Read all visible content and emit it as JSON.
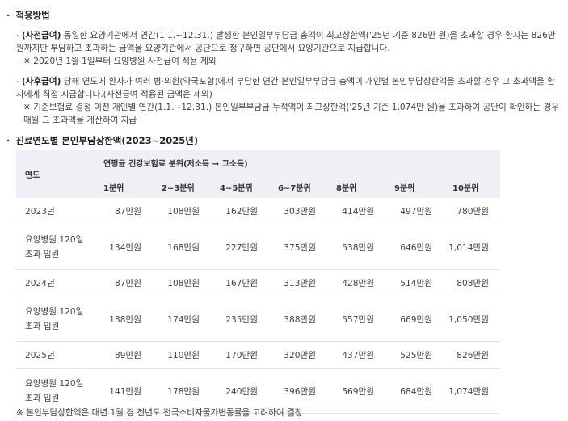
{
  "section1": {
    "title": "적용방법",
    "advance": {
      "dash": "-",
      "tag": "(사전급여)",
      "text": "동일한 요양기관에서 연간(1.1.~12.31.) 발생한 본인일부부담금 총액이 최고상한액('25년 기준 826만 원)을 초과할 경우 환자는 826만 원까지만 부담하고 초과하는 금액을 요양기관에서 공단으로 청구하면 공단에서 요양기관으로 지급합니다.",
      "note": "※ 2020년 1월 1일부터 요양병원 사전급여 적용 제외"
    },
    "post": {
      "dash": "-",
      "tag": "(사후급여)",
      "text": "당해 연도에 환자가 여러 병·의원(약국포함)에서 부담한 연간 본인일부부담금 총액이 개인별 본인부담상한액을 초과할 경우 그 초과액을 환자에게 직접 지급합니다.(사전급여 적용된 금액은 제외)",
      "note": "※ 기준보험료 결정 이전 개인별 연간(1.1.~12.31.) 본인일부부담금 누적액이 최고상한액('25년 기준 1,074만 원)을 초과하여 공단이 확인하는 경우 매월 그 초과액을 계산하여 지급"
    }
  },
  "section2": {
    "title": "진료연도별 본인부담상한액(2023~2025년)"
  },
  "bullet": "·",
  "table": {
    "year_header": "연도",
    "group_header": "연평균 건강보험료 분위(저소득 → 고소득)",
    "quantiles": [
      "1분위",
      "2~3분위",
      "4~5분위",
      "6~7분위",
      "8분위",
      "9분위",
      "10분위"
    ],
    "rows": [
      {
        "label": "2023년",
        "values": [
          "87만원",
          "108만원",
          "162만원",
          "303만원",
          "414만원",
          "497만원",
          "780만원"
        ]
      },
      {
        "label": "요양병원 120일 초과 입원",
        "values": [
          "134만원",
          "168만원",
          "227만원",
          "375만원",
          "538만원",
          "646만원",
          "1,014만원"
        ]
      },
      {
        "label": "2024년",
        "values": [
          "87만원",
          "108만원",
          "167만원",
          "313만원",
          "428만원",
          "514만원",
          "808만원"
        ]
      },
      {
        "label": "요양병원 120일 초과 입원",
        "values": [
          "138만원",
          "174만원",
          "235만원",
          "388만원",
          "557만원",
          "669만원",
          "1,050만원"
        ]
      },
      {
        "label": "2025년",
        "values": [
          "89만원",
          "110만원",
          "170만원",
          "320만원",
          "437만원",
          "525만원",
          "826만원"
        ]
      },
      {
        "label": "요양병원 120일 초과 입원",
        "values": [
          "141만원",
          "178만원",
          "240만원",
          "396만원",
          "569만원",
          "684만원",
          "1,074만원"
        ]
      }
    ]
  },
  "footnote": "※ 본인부담상한액은 매년 1월 경 전년도 전국소비자물가변동률을 고려하여 결정"
}
